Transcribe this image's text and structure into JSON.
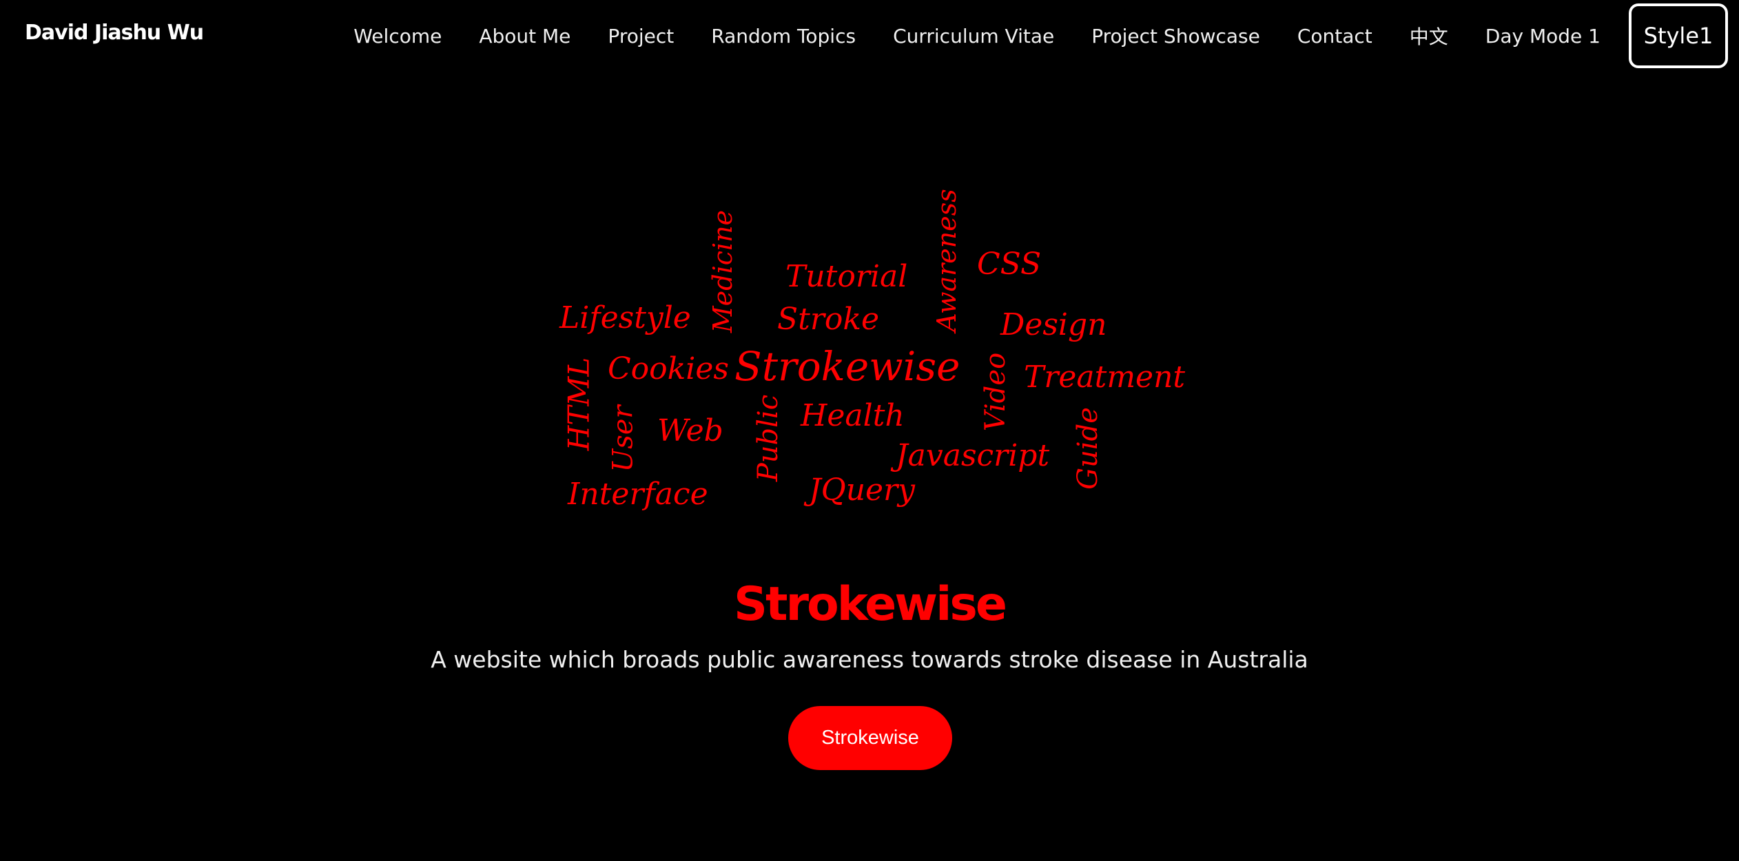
{
  "navbar": {
    "brand": "David Jiashu Wu",
    "links": [
      "Welcome",
      "About Me",
      "Project",
      "Random Topics",
      "Curriculum Vitae",
      "Project Showcase",
      "Contact",
      "中文",
      "Day Mode 1"
    ],
    "style_button": "Style1"
  },
  "word_cloud": {
    "color": "#ff0000",
    "words": [
      "Awareness",
      "CSS",
      "Medicine",
      "Tutorial",
      "Lifestyle",
      "Stroke",
      "Design",
      "HTML",
      "Cookies",
      "Strokewise",
      "Video",
      "Treatment",
      "User",
      "Web",
      "Public",
      "Health",
      "Guide",
      "Javascript",
      "Interface",
      "JQuery"
    ]
  },
  "project": {
    "title": "Strokewise",
    "description": "A website which broads public awareness towards stroke disease in Australia",
    "button_label": "Strokewise"
  },
  "colors": {
    "background": "#000000",
    "accent": "#ff0000",
    "text": "#f0f0f0"
  }
}
